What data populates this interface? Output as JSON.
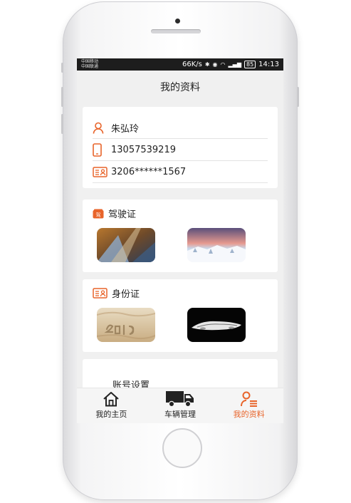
{
  "status_bar": {
    "carrier_1": "中国移动",
    "carrier_2": "中国联通",
    "speed": "66K/s",
    "battery": "85",
    "time": "14:13"
  },
  "header": {
    "title": "我的资料"
  },
  "profile": {
    "name": "朱弘玲",
    "phone": "13057539219",
    "id_number": "3206******1567"
  },
  "license_section": {
    "title": "驾驶证",
    "icon_text": "驾"
  },
  "id_section": {
    "title": "身份证"
  },
  "settings": {
    "label": "账号设置"
  },
  "tabs": [
    {
      "label": "我的主页",
      "icon": "home-icon",
      "active": false
    },
    {
      "label": "车辆管理",
      "icon": "truck-icon",
      "active": false
    },
    {
      "label": "我的资料",
      "icon": "profile-icon",
      "active": true
    }
  ],
  "colors": {
    "accent": "#e8642a",
    "background": "#f0f0f0",
    "card": "#ffffff"
  }
}
